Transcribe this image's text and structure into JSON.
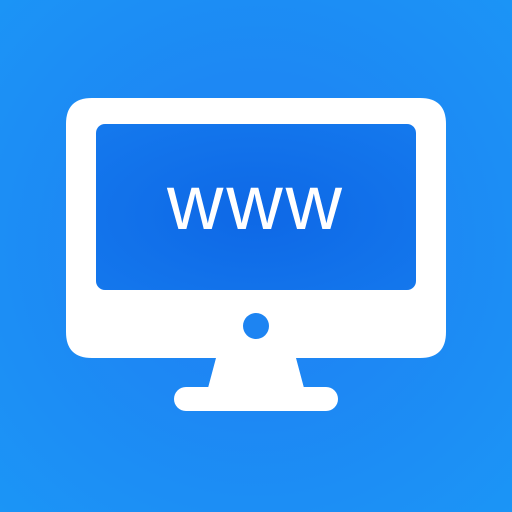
{
  "icon": {
    "name": "monitor-www-icon",
    "screen_text": "www",
    "colors": {
      "background": "#1d88f4",
      "screen": "#0f6ee8",
      "foreground": "#ffffff"
    }
  }
}
